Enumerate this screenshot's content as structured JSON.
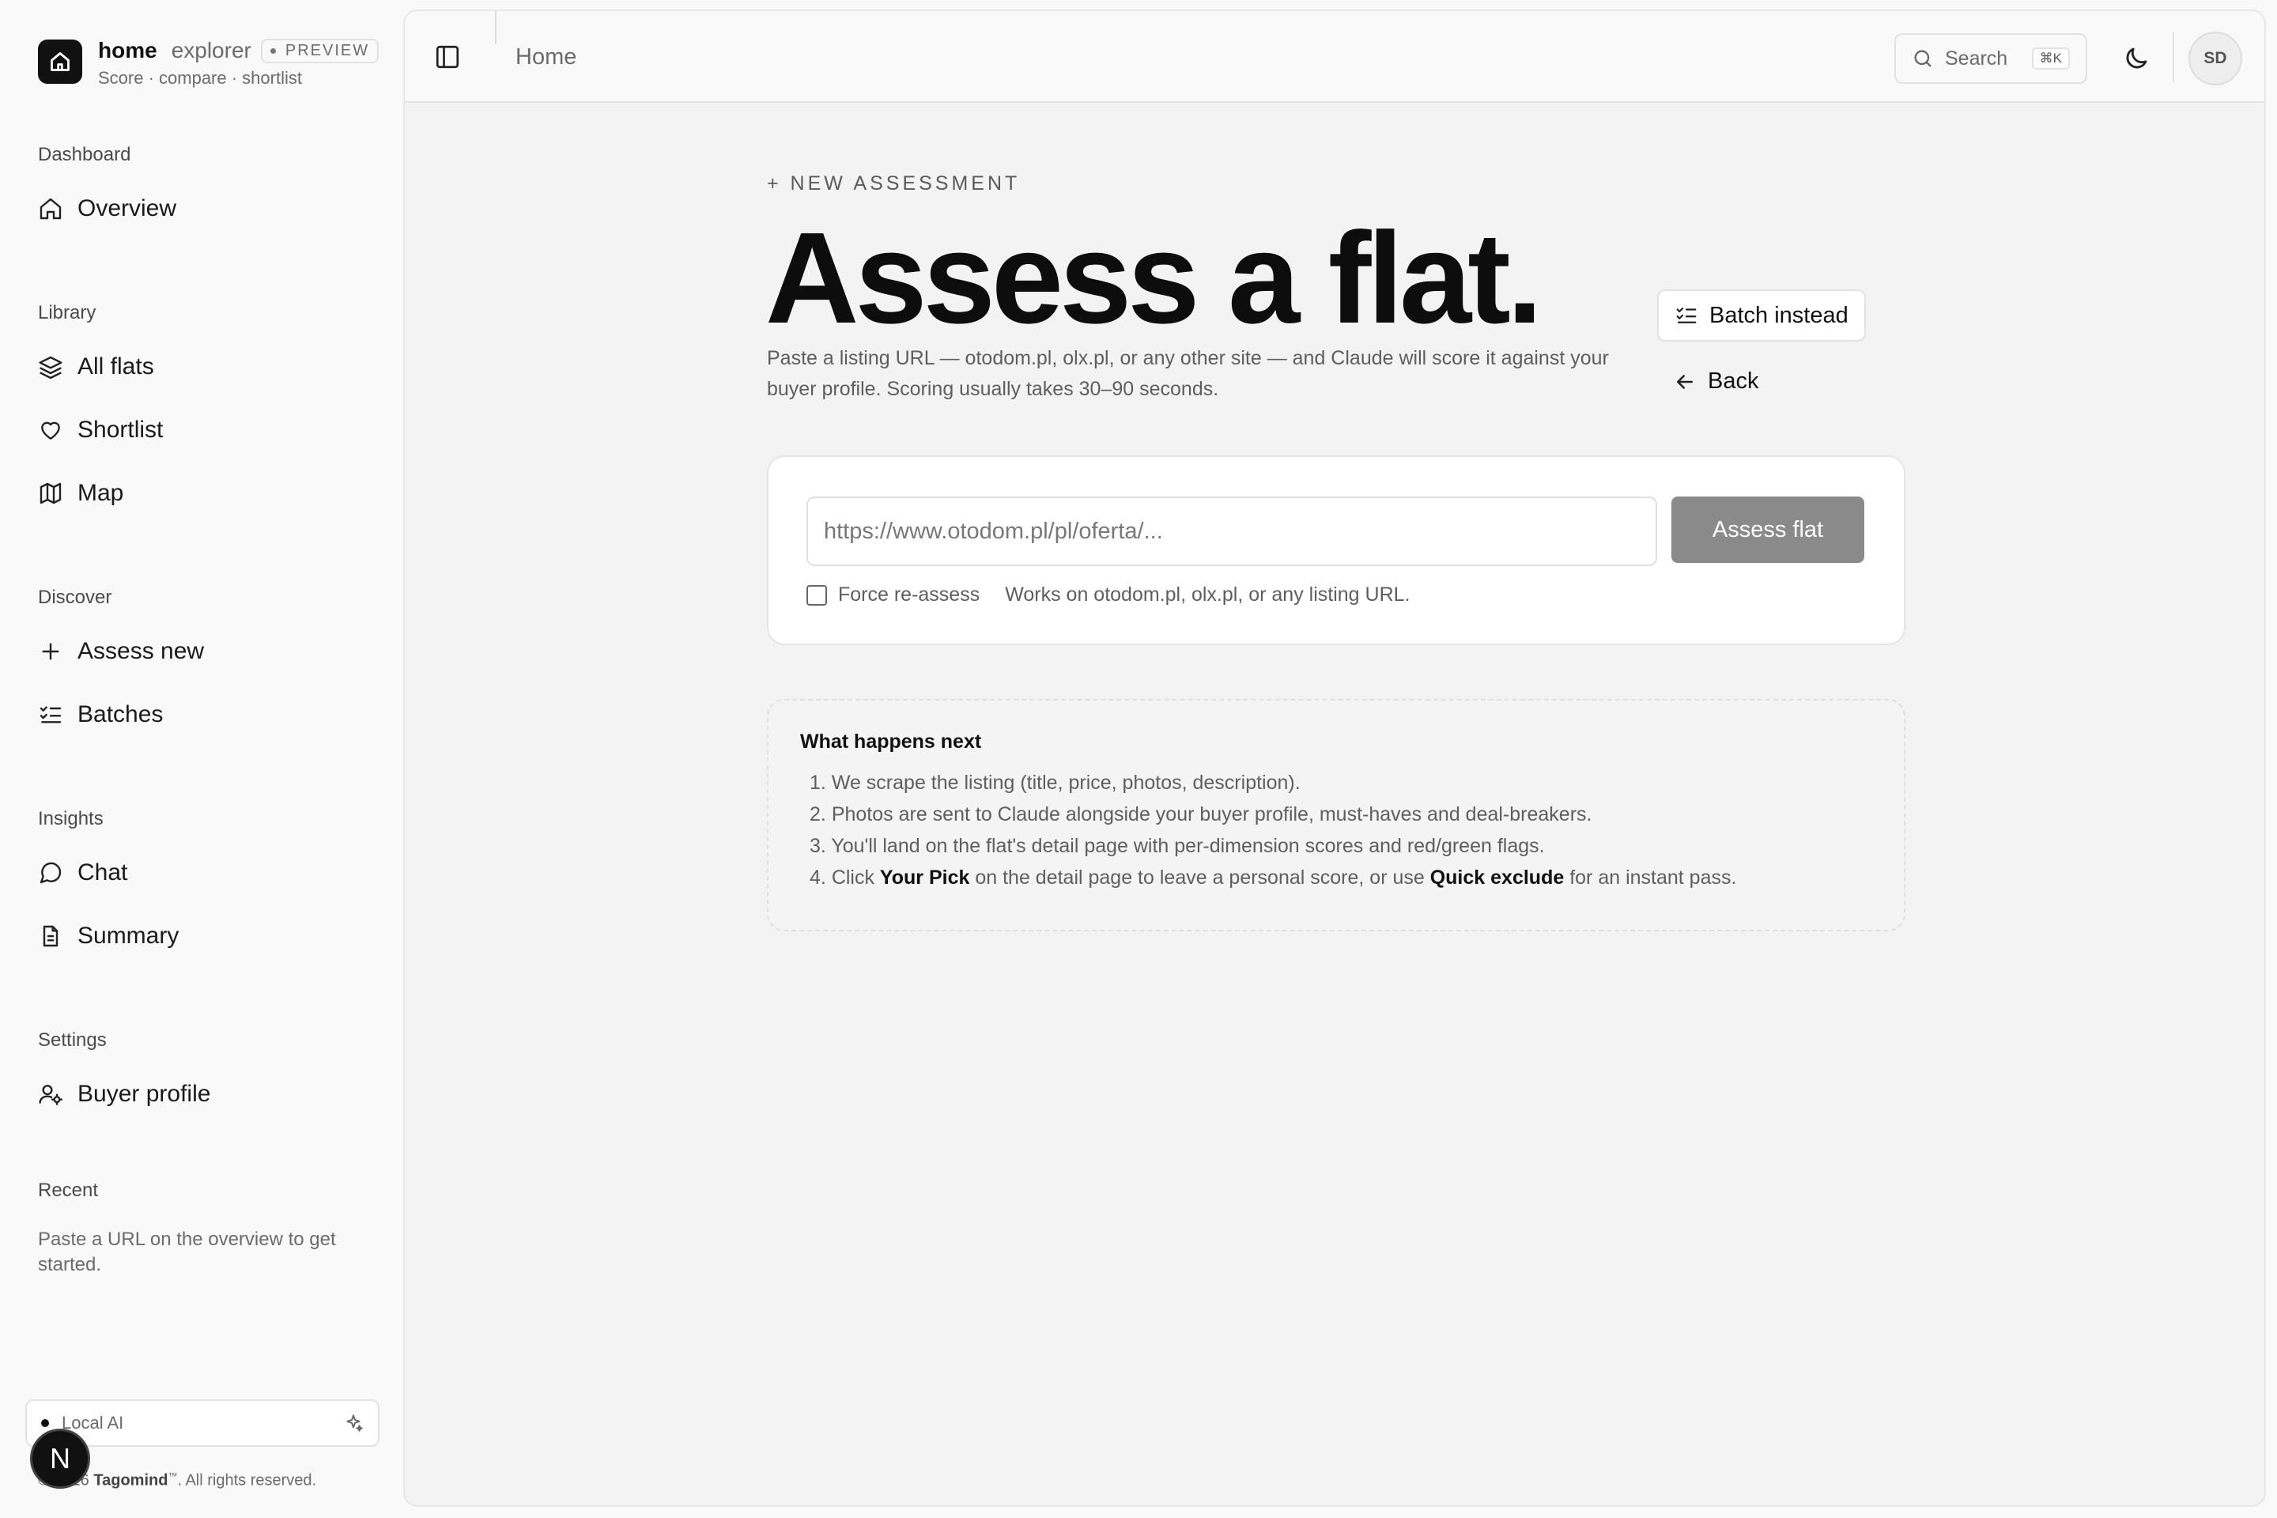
{
  "brand": {
    "name": "home",
    "sub_name": "explorer",
    "badge": "PREVIEW",
    "tagline": "Score · compare · shortlist"
  },
  "sidebar": {
    "sections": [
      {
        "label": "Dashboard",
        "items": [
          {
            "label": "Overview",
            "icon": "home-icon"
          }
        ]
      },
      {
        "label": "Library",
        "items": [
          {
            "label": "All flats",
            "icon": "layers-icon"
          },
          {
            "label": "Shortlist",
            "icon": "heart-icon"
          },
          {
            "label": "Map",
            "icon": "map-icon"
          }
        ]
      },
      {
        "label": "Discover",
        "items": [
          {
            "label": "Assess new",
            "icon": "plus-icon"
          },
          {
            "label": "Batches",
            "icon": "list-checks-icon"
          }
        ]
      },
      {
        "label": "Insights",
        "items": [
          {
            "label": "Chat",
            "icon": "message-circle-icon"
          },
          {
            "label": "Summary",
            "icon": "file-text-icon"
          }
        ]
      },
      {
        "label": "Settings",
        "items": [
          {
            "label": "Buyer profile",
            "icon": "user-cog-icon"
          }
        ]
      },
      {
        "label": "Recent",
        "items": []
      }
    ],
    "recent_empty": "Paste a URL on the overview to get started.",
    "local_ai": {
      "label": "Local AI",
      "icon": "sparkles-icon"
    },
    "copyright_prefix": "©",
    "copyright_year": "2026",
    "copyright_company": "Tagomind",
    "copyright_suffix": ". All rights reserved.",
    "overlay_badge": "N"
  },
  "topbar": {
    "breadcrumb": "Home",
    "search_label": "Search",
    "search_shortcut": "⌘K",
    "avatar_initials": "SD"
  },
  "main": {
    "eyebrow": "+ NEW ASSESSMENT",
    "title": "Assess a flat.",
    "subtitle": "Paste a listing URL — otodom.pl, olx.pl, or any other site — and Claude will score it against your buyer profile. Scoring usually takes 30–90 seconds.",
    "batch_button": "Batch instead",
    "back_button": "Back",
    "form": {
      "url_placeholder": "https://www.otodom.pl/pl/oferta/...",
      "url_value": "",
      "submit_label": "Assess flat",
      "force_label": "Force re-assess",
      "force_checked": false,
      "hint": "Works on otodom.pl, olx.pl, or any listing URL."
    },
    "next": {
      "title": "What happens next",
      "steps": [
        {
          "n": "1.",
          "text": "We scrape the listing (title, price, photos, description)."
        },
        {
          "n": "2.",
          "text": "Photos are sent to Claude alongside your buyer profile, must-haves and deal-breakers."
        },
        {
          "n": "3.",
          "text": "You'll land on the flat's detail page with per-dimension scores and red/green flags."
        }
      ],
      "step4": {
        "n": "4.",
        "pre": "Click ",
        "bold1": "Your Pick",
        "mid": " on the detail page to leave a personal score, or use ",
        "bold2": "Quick exclude",
        "post": " for an instant pass."
      }
    }
  }
}
